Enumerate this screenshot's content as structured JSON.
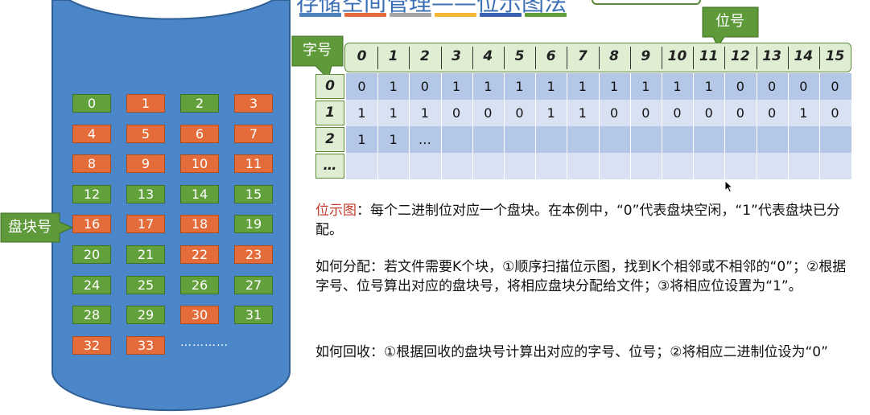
{
  "title": "存储空间管理——位示图法",
  "title_bar_colors": [
    "#4f81bd",
    "#e36c3a",
    "#a5a5a5",
    "#f6b638",
    "#3a62b0",
    "#62a03c"
  ],
  "disk": {
    "label": "盘块号",
    "blocks": [
      {
        "n": "0",
        "c": "g"
      },
      {
        "n": "1",
        "c": "o"
      },
      {
        "n": "2",
        "c": "g"
      },
      {
        "n": "3",
        "c": "o"
      },
      {
        "n": "4",
        "c": "o"
      },
      {
        "n": "5",
        "c": "o"
      },
      {
        "n": "6",
        "c": "o"
      },
      {
        "n": "7",
        "c": "o"
      },
      {
        "n": "8",
        "c": "o"
      },
      {
        "n": "9",
        "c": "o"
      },
      {
        "n": "10",
        "c": "o"
      },
      {
        "n": "11",
        "c": "o"
      },
      {
        "n": "12",
        "c": "g"
      },
      {
        "n": "13",
        "c": "g"
      },
      {
        "n": "14",
        "c": "g"
      },
      {
        "n": "15",
        "c": "g"
      },
      {
        "n": "16",
        "c": "o"
      },
      {
        "n": "17",
        "c": "o"
      },
      {
        "n": "18",
        "c": "o"
      },
      {
        "n": "19",
        "c": "g"
      },
      {
        "n": "20",
        "c": "g"
      },
      {
        "n": "21",
        "c": "g"
      },
      {
        "n": "22",
        "c": "o"
      },
      {
        "n": "23",
        "c": "o"
      },
      {
        "n": "24",
        "c": "g"
      },
      {
        "n": "25",
        "c": "g"
      },
      {
        "n": "26",
        "c": "g"
      },
      {
        "n": "27",
        "c": "g"
      },
      {
        "n": "28",
        "c": "g"
      },
      {
        "n": "29",
        "c": "g"
      },
      {
        "n": "30",
        "c": "o"
      },
      {
        "n": "31",
        "c": "g"
      },
      {
        "n": "32",
        "c": "o"
      },
      {
        "n": "33",
        "c": "o"
      }
    ],
    "ellipsis": "…………",
    "fill_color": "#4a86c8",
    "used_color": "#e36c3a",
    "free_color": "#62a03c"
  },
  "bitmap": {
    "word_label": "字号",
    "bit_label": "位号",
    "bit_headers": [
      "0",
      "1",
      "2",
      "3",
      "4",
      "5",
      "6",
      "7",
      "8",
      "9",
      "10",
      "11",
      "12",
      "13",
      "14",
      "15"
    ],
    "row_labels": [
      "0",
      "1",
      "2",
      "…"
    ],
    "rows": [
      [
        "0",
        "1",
        "0",
        "1",
        "1",
        "1",
        "1",
        "1",
        "1",
        "1",
        "1",
        "1",
        "0",
        "0",
        "0",
        "0"
      ],
      [
        "1",
        "1",
        "1",
        "0",
        "0",
        "0",
        "1",
        "1",
        "0",
        "0",
        "0",
        "0",
        "0",
        "0",
        "1",
        "0"
      ],
      [
        "1",
        "1",
        "…",
        "",
        "",
        "",
        "",
        "",
        "",
        "",
        "",
        "",
        "",
        "",
        "",
        ""
      ],
      [
        "",
        "",
        "",
        "",
        "",
        "",
        "",
        "",
        "",
        "",
        "",
        "",
        "",
        "",
        "",
        ""
      ]
    ],
    "row_colors": [
      "#b4c7e7",
      "#d9e2f3",
      "#b4c7e7",
      "#d9e2f3"
    ]
  },
  "text": {
    "p1_term": "位示图",
    "p1_rest": "：每个二进制位对应一个盘块。在本例中，“0”代表盘块空闲，“1”代表盘块已分配。",
    "p2": "如何分配：若文件需要K个块，①顺序扫描位示图，找到K个相邻或不相邻的“0”；②根据字号、位号算出对应的盘块号，将相应盘块分配给文件；③将相应位设置为“1”。",
    "p3": "如何回收：①根据回收的盘块号计算出对应的字号、位号；②将相应二进制位设为“0”"
  }
}
